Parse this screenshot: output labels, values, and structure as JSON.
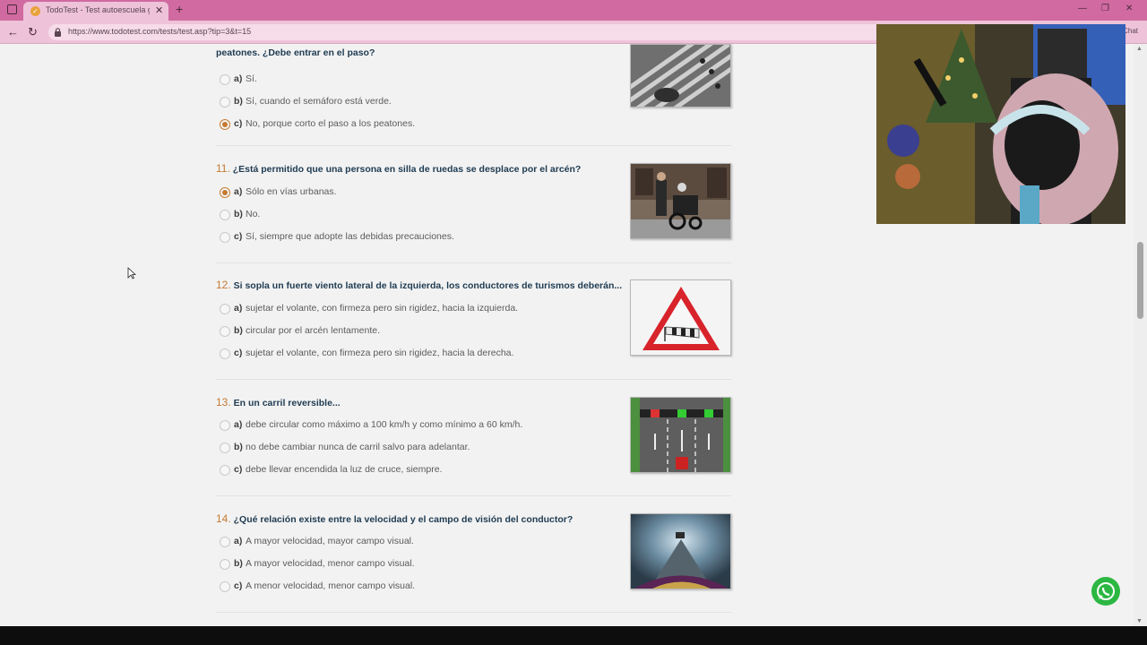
{
  "browser": {
    "tab_title": "TodoTest - Test autoescuela gratis",
    "url": "https://www.todotest.com/tests/test.asp?tip=3&t=15",
    "chat_label": "Chat",
    "new_tab_symbol": "+",
    "close_symbol": "✕"
  },
  "questions": [
    {
      "number": "",
      "text": "peatones. ¿Debe entrar en el paso?",
      "image": "pedestrian-crossing-photo",
      "answers": [
        {
          "letter": "a)",
          "text": "Sí.",
          "checked": false
        },
        {
          "letter": "b)",
          "text": "Sí, cuando el semáforo está verde.",
          "checked": false
        },
        {
          "letter": "c)",
          "text": "No, porque corto el paso a los peatones.",
          "checked": true
        }
      ]
    },
    {
      "number": "11.",
      "text": "¿Está permitido que una persona en silla de ruedas se desplace por el arcén?",
      "image": "wheelchair-photo",
      "answers": [
        {
          "letter": "a)",
          "text": "Sólo en vías urbanas.",
          "checked": true
        },
        {
          "letter": "b)",
          "text": "No.",
          "checked": false
        },
        {
          "letter": "c)",
          "text": "Sí, siempre que adopte las debidas precauciones.",
          "checked": false
        }
      ]
    },
    {
      "number": "12.",
      "text": "Si sopla un fuerte viento lateral de la izquierda, los conductores de turismos deberán...",
      "image": "crosswind-warning-sign",
      "answers": [
        {
          "letter": "a)",
          "text": "sujetar el volante, con firmeza pero sin rigidez, hacia la izquierda.",
          "checked": false
        },
        {
          "letter": "b)",
          "text": "circular por el arcén lentamente.",
          "checked": false
        },
        {
          "letter": "c)",
          "text": "sujetar el volante, con firmeza pero sin rigidez, hacia la derecha.",
          "checked": false
        }
      ]
    },
    {
      "number": "13.",
      "text": "En un carril reversible...",
      "image": "reversible-lane-diagram",
      "answers": [
        {
          "letter": "a)",
          "text": "debe circular como máximo a 100 km/h y como mínimo a 60 km/h.",
          "checked": false
        },
        {
          "letter": "b)",
          "text": "no debe cambiar nunca de carril salvo para adelantar.",
          "checked": false
        },
        {
          "letter": "c)",
          "text": "debe llevar encendida la luz de cruce, siempre.",
          "checked": false
        }
      ]
    },
    {
      "number": "14.",
      "text": "¿Qué relación existe entre la velocidad y el campo de visión del conductor?",
      "image": "speed-vision-photo",
      "answers": [
        {
          "letter": "a)",
          "text": "A mayor velocidad, mayor campo visual.",
          "checked": false
        },
        {
          "letter": "b)",
          "text": "A mayor velocidad, menor campo visual.",
          "checked": false
        },
        {
          "letter": "c)",
          "text": "A menor velocidad, menor campo visual.",
          "checked": false
        }
      ]
    }
  ],
  "colors": {
    "accent": "#c47a32",
    "question_text": "#1e3b52",
    "tab_bar": "#d06aa0",
    "whatsapp": "#2cb742"
  },
  "icons": [
    "window-icon",
    "favicon-icon",
    "back-arrow-icon",
    "reload-icon",
    "lock-icon",
    "whatsapp-icon",
    "mouse-cursor-icon"
  ]
}
